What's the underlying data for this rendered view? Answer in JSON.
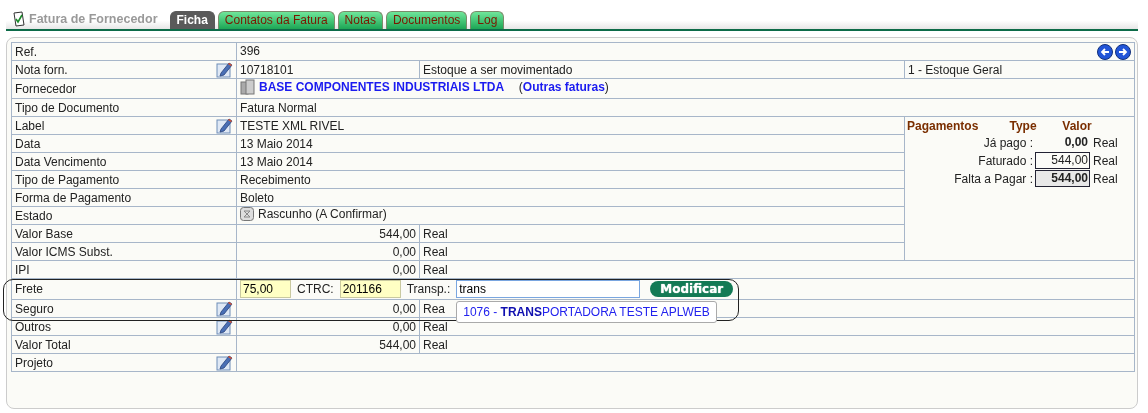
{
  "header": {
    "title": "Fatura de Fornecedor"
  },
  "tabs": [
    {
      "label": "Ficha",
      "selected": true
    },
    {
      "label": "Contatos da Fatura",
      "selected": false
    },
    {
      "label": "Notas",
      "selected": false
    },
    {
      "label": "Documentos",
      "selected": false
    },
    {
      "label": "Log",
      "selected": false
    }
  ],
  "rows": [
    {
      "kind": "ref",
      "label": "Ref.",
      "editable": false,
      "value": "396"
    },
    {
      "kind": "stock",
      "label": "Nota forn.",
      "editable": true,
      "value": "10718101",
      "movement": "Estoque a ser movimentado",
      "warehouse": "1 - Estoque Geral"
    },
    {
      "kind": "supplier",
      "label": "Fornecedor",
      "editable": false,
      "value": "BASE COMPONENTES INDUSTRIAIS LTDA",
      "link": "(**Outras faturas**)"
    },
    {
      "kind": "text",
      "label": "Tipo de Documento",
      "editable": false,
      "value": "Fatura Normal"
    },
    {
      "kind": "text",
      "label": "Label",
      "editable": true,
      "value": "TESTE XML RIVEL"
    },
    {
      "kind": "text",
      "label": "Data",
      "editable": false,
      "value": "13 Maio 2014"
    },
    {
      "kind": "text",
      "label": "Data Vencimento",
      "editable": false,
      "value": "13 Maio 2014"
    },
    {
      "kind": "text",
      "label": "Tipo de Pagamento",
      "editable": false,
      "value": "Recebimento"
    },
    {
      "kind": "text",
      "label": "Forma de Pagamento",
      "editable": false,
      "value": "Boleto"
    },
    {
      "kind": "status",
      "label": "Estado",
      "editable": false,
      "value": "Rascunho (A Confirmar)"
    },
    {
      "kind": "amount",
      "label": "Valor Base",
      "editable": false,
      "value": "544,00",
      "currency": "Real"
    },
    {
      "kind": "amount",
      "label": "Valor ICMS Subst.",
      "editable": false,
      "value": "0,00",
      "currency": "Real"
    },
    {
      "kind": "amount",
      "label": "IPI",
      "editable": false,
      "value": "0,00",
      "currency": "Real"
    },
    {
      "kind": "frete",
      "label": "Frete",
      "editable": false,
      "value": "75,00",
      "ctrc_label": "CTRC:",
      "ctrc": "201166",
      "transp_label": "Transp.:",
      "transp": "trans",
      "button": "Modificar",
      "suggestion": "1076 - **TRANS**PORTADORA TESTE APLWEB"
    },
    {
      "kind": "amount",
      "label": "Seguro",
      "editable": true,
      "value": "0,00",
      "currency": "Rea"
    },
    {
      "kind": "amount",
      "label": "Outros",
      "editable": true,
      "value": "0,00",
      "currency": "Real"
    },
    {
      "kind": "amount",
      "label": "Valor Total",
      "editable": false,
      "value": "544,00",
      "currency": "Real"
    },
    {
      "kind": "text",
      "label": "Projeto",
      "editable": true
    }
  ],
  "payments": {
    "headers": [
      "Pagamentos",
      "Type",
      "Valor"
    ],
    "lines": [
      {
        "kind": "plain",
        "label": "Já pago :",
        "value": "0,00",
        "currency": "Real"
      },
      {
        "kind": "boxed",
        "label": "Faturado :",
        "value": "544,00",
        "currency": "Real"
      },
      {
        "kind": "total",
        "label": "Falta a Pagar :",
        "value": "544,00",
        "currency": "Real"
      }
    ]
  }
}
